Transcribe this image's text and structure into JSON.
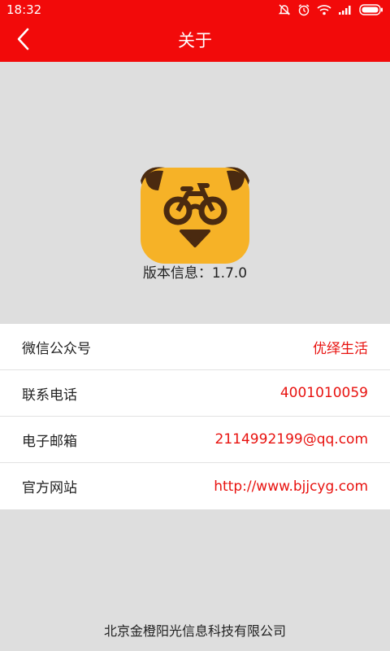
{
  "status_bar": {
    "time": "18:32",
    "icons": [
      "mute-icon",
      "alarm-icon",
      "wifi-icon",
      "signal-icon",
      "battery-icon"
    ]
  },
  "app_bar": {
    "title": "关于",
    "back_icon": "chevron-left-icon"
  },
  "about": {
    "logo_icon": "bear-bike-logo-icon",
    "version_text": "版本信息：1.7.0"
  },
  "info_items": [
    {
      "label": "微信公众号",
      "value": "优绎生活"
    },
    {
      "label": "联系电话",
      "value": "4001010059"
    },
    {
      "label": "电子邮箱",
      "value": "2114992199@qq.com"
    },
    {
      "label": "官方网站",
      "value": "http://www.bjjcyg.com"
    }
  ],
  "footer": {
    "company": "北京金橙阳光信息科技有限公司"
  },
  "colors": {
    "brand_red": "#f20a0a",
    "value_red": "#e8120f",
    "background_gray": "#dedede",
    "logo_yellow": "#f6b227",
    "logo_brown": "#4a2a10"
  }
}
